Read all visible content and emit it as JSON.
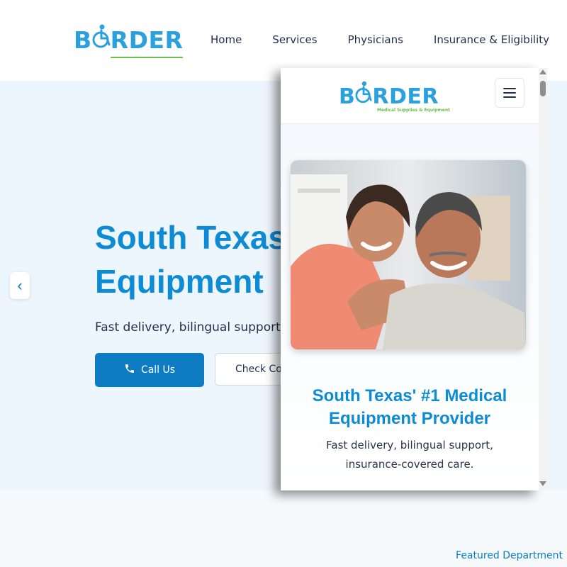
{
  "brand": {
    "logo_text_left": "B",
    "logo_text_right": "RDER",
    "tagline": "Medical Supplies & Equipment",
    "color": "#2aa0dd",
    "accent": "#6cc04a"
  },
  "nav": {
    "items": [
      {
        "label": "Home"
      },
      {
        "label": "Services"
      },
      {
        "label": "Physicians"
      },
      {
        "label": "Insurance & Eligibility"
      }
    ]
  },
  "hero": {
    "title": "South Texas\nEquipment",
    "subtitle": "Fast delivery, bilingual support,",
    "call_button": "Call Us",
    "check_button": "Check Cov",
    "prev_arrow": "‹"
  },
  "featured": {
    "label": "Featured Department"
  },
  "mobile": {
    "title": "South Texas' #1 Medical Equipment Provider",
    "subtitle": "Fast delivery, bilingual support, insurance-covered care."
  },
  "colors": {
    "primary": "#0e7cc2",
    "title_blue": "#0d8bd4",
    "hero_bg": "#eef6fd",
    "text_dark": "#1f2f4a"
  }
}
